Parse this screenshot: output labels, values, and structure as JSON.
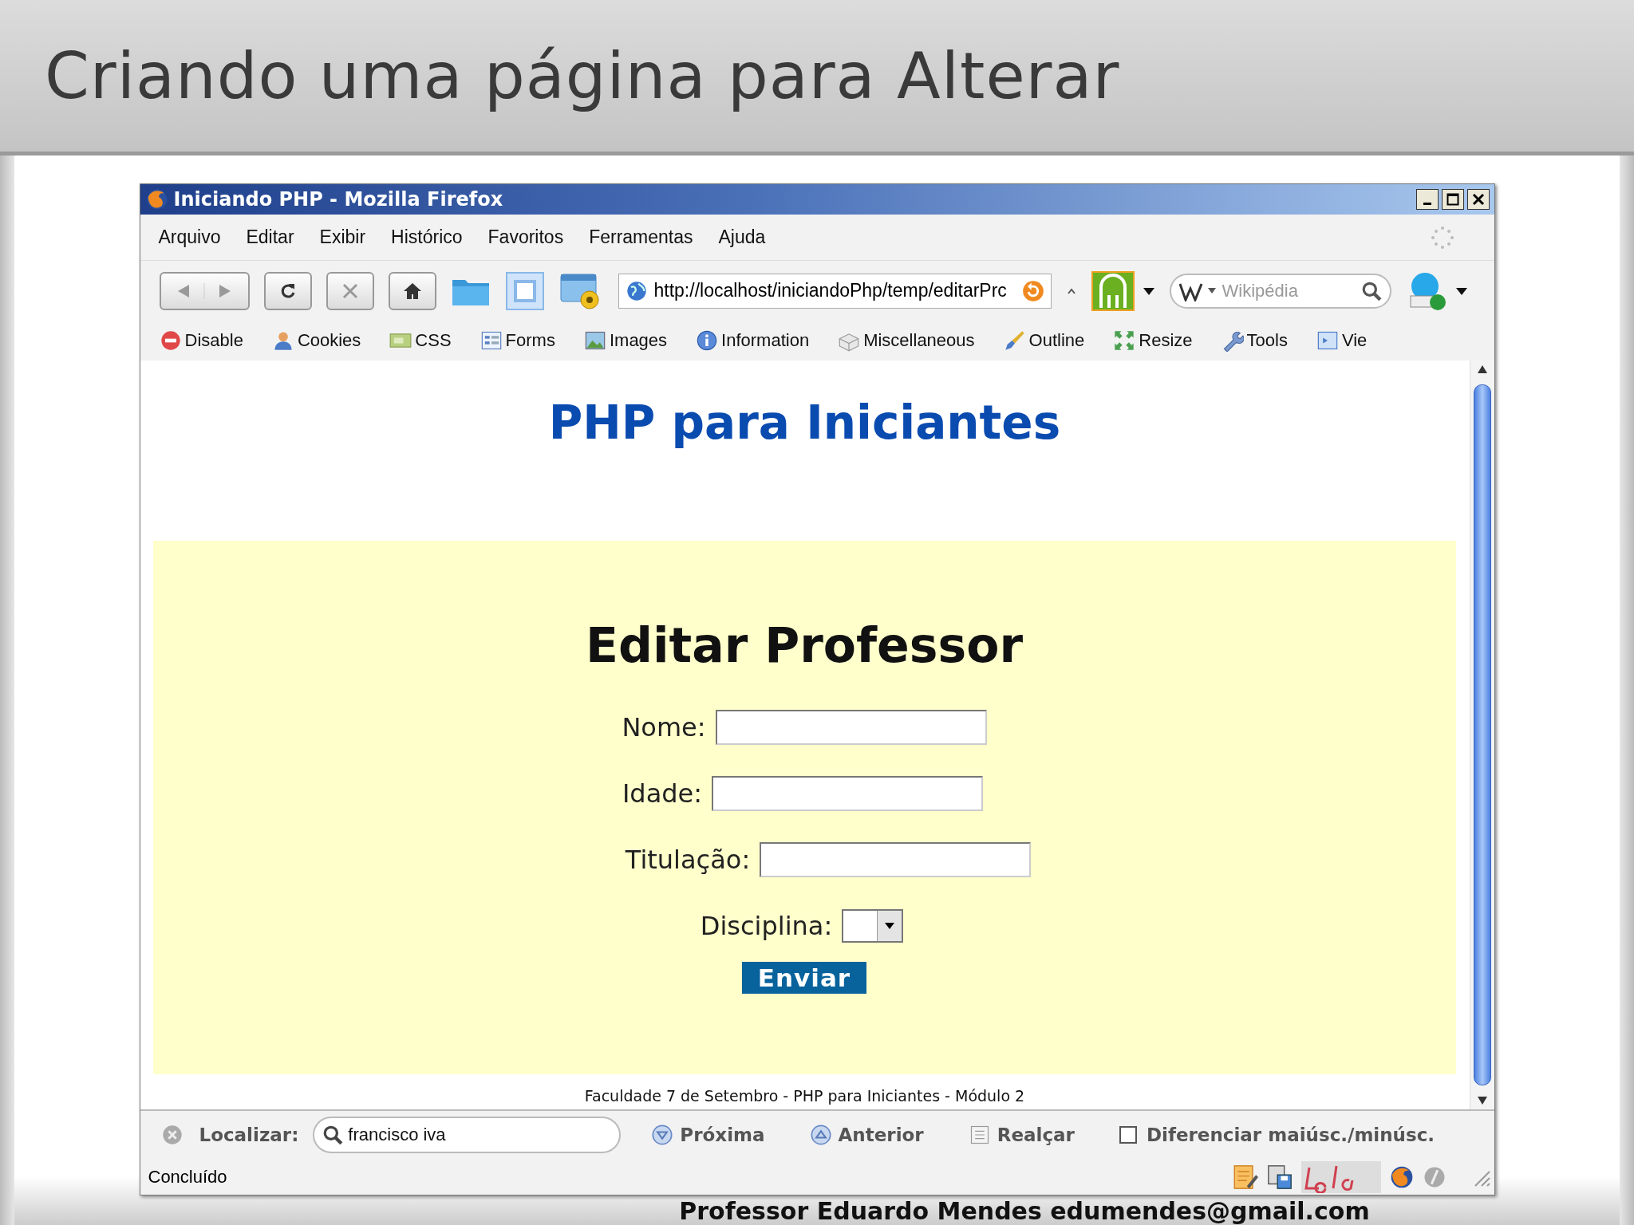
{
  "slide": {
    "title": "Criando uma página para Alterar",
    "footer": "Professor Eduardo Mendes edumendes@gmail.com"
  },
  "window": {
    "title": "Iniciando PHP - Mozilla Firefox"
  },
  "menu": [
    "Arquivo",
    "Editar",
    "Exibir",
    "Histórico",
    "Favoritos",
    "Ferramentas",
    "Ajuda"
  ],
  "address": {
    "value": "http://localhost/iniciandoPhp/temp/editarPrc"
  },
  "search": {
    "placeholder": "Wikipédia"
  },
  "dev_toolbar": [
    "Disable",
    "Cookies",
    "CSS",
    "Forms",
    "Images",
    "Information",
    "Miscellaneous",
    "Outline",
    "Resize",
    "Tools",
    "Vie"
  ],
  "page": {
    "heading": "PHP para Iniciantes",
    "form_title": "Editar Professor",
    "fields": [
      {
        "kind": "text",
        "label": "Nome:"
      },
      {
        "kind": "text",
        "label": "Idade:"
      },
      {
        "kind": "text",
        "label": "Titulação:"
      },
      {
        "kind": "select",
        "label": "Disciplina:"
      }
    ],
    "submit": "Enviar",
    "footer": "Faculdade 7 de Setembro - PHP para Iniciantes - Módulo 2"
  },
  "find_bar": {
    "label": "Localizar:",
    "value": "francisco iva",
    "buttons": [
      "Próxima",
      "Anterior",
      "Realçar"
    ],
    "match_case": {
      "label": "Diferenciar maiúsc./minúsc.",
      "checked": false
    }
  },
  "status_bar": {
    "text": "Concluído"
  }
}
